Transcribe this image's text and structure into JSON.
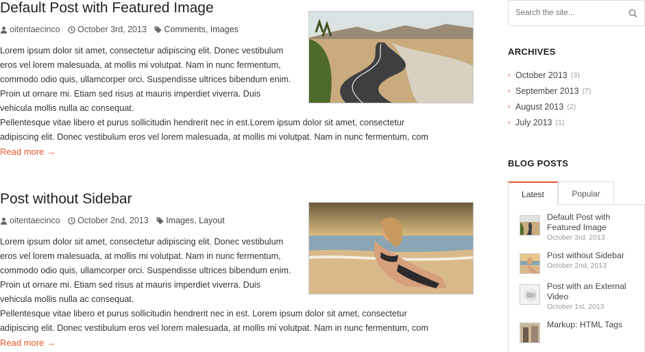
{
  "posts": [
    {
      "title": "Default Post with Featured Image",
      "author": "oitentaecinco",
      "date": "October 3rd, 2013",
      "categories": [
        "Comments",
        "Images"
      ],
      "para1": "Lorem ipsum dolor sit amet, consectetur adipiscing elit. Donec vestibulum eros vel lorem malesuada, at mollis mi volutpat. Nam in nunc fermentum, commodo odio quis, ullamcorper orci. Suspendisse ultrices bibendum enim. Proin ut ornare mi. Etiam sed risus at mauris imperdiet viverra. Duis vehicula mollis nulla ac consequat.",
      "para2_line1": "Pellentesque vitae libero et purus sollicitudin hendrerit nec in est.Lorem ipsum dolor sit amet, consectetur",
      "para2_line2": "adipiscing elit. Donec vestibulum eros vel lorem malesuada, at mollis mi volutpat. Nam in nunc fermentum, com",
      "read_more": "Read more →"
    },
    {
      "title": "Post without Sidebar",
      "author": "oitentaecinco",
      "date": "October 2nd, 2013",
      "categories": [
        "Images",
        "Layout"
      ],
      "para1": "Lorem ipsum dolor sit amet, consectetur adipiscing elit. Donec vestibulum eros vel lorem malesuada, at mollis mi volutpat. Nam in nunc fermentum, commodo odio quis, ullamcorper orci. Suspendisse ultrices bibendum enim. Proin ut ornare mi. Etiam sed risus at mauris imperdiet viverra. Duis vehicula mollis nulla ac consequat.",
      "para2_line1": "Pellentesque vitae libero et purus sollicitudin hendrerit nec in est. Lorem ipsum dolor sit amet, consectetur",
      "para2_line2": "adipiscing elit. Donec vestibulum eros vel lorem malesuada, at mollis mi volutpat. Nam in nunc fermentum, com",
      "read_more": "Read more →"
    }
  ],
  "sidebar": {
    "search_placeholder": "Search the site...",
    "archives_title": "ARCHIVES",
    "archives": [
      {
        "label": "October 2013",
        "count": "(3)"
      },
      {
        "label": "September 2013",
        "count": "(7)"
      },
      {
        "label": "August 2013",
        "count": "(2)"
      },
      {
        "label": "July 2013",
        "count": "(1)"
      }
    ],
    "blog_posts_title": "BLOG POSTS",
    "tabs": [
      "Latest",
      "Popular"
    ],
    "latest": [
      {
        "title": "Default Post with Featured Image",
        "date": "October 3rd, 2013"
      },
      {
        "title": "Post without Sidebar",
        "date": "October 2nd, 2013"
      },
      {
        "title": "Post with an External Video",
        "date": "October 1st, 2013"
      },
      {
        "title": "Markup: HTML Tags",
        "date": ""
      }
    ]
  },
  "colors": {
    "accent": "#e8562a",
    "text": "#333333",
    "muted": "#999999",
    "border": "#dddddd"
  },
  "icons": {
    "author": "user-icon",
    "date": "clock-icon",
    "tags": "tag-icon",
    "search": "search-icon",
    "archive_bullet": "chevron-right-icon"
  }
}
